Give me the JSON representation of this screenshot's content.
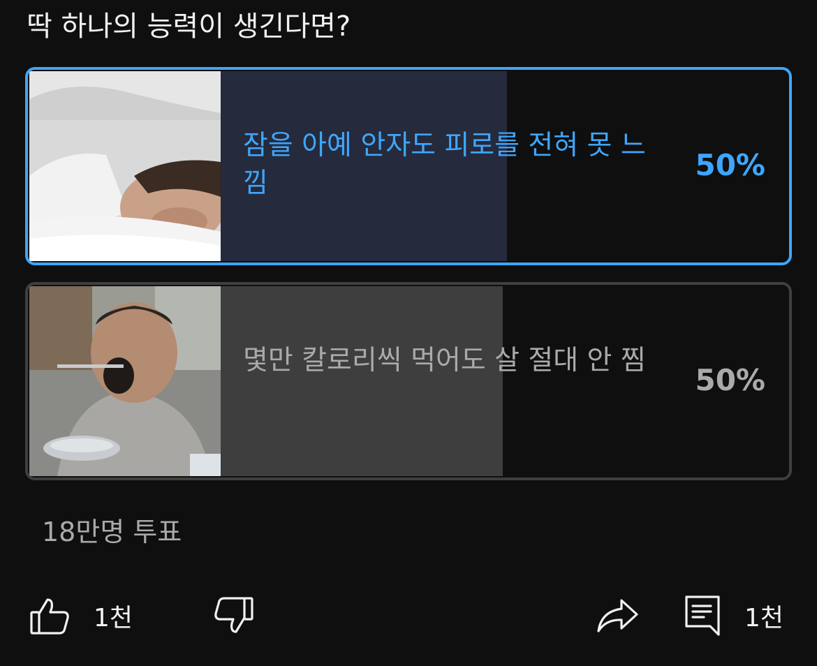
{
  "poll": {
    "question": "딱 하나의 능력이 생긴다면?",
    "options": [
      {
        "label": "잠을 아예 안자도 피로를 전혀 못 느낌",
        "percent": "50%",
        "fill_fraction": 0.5,
        "selected": true,
        "image": "sleeping-man-photo"
      },
      {
        "label": "몇만 칼로리씩 먹어도 살 절대 안 찜",
        "percent": "50%",
        "fill_fraction": 0.5,
        "selected": false,
        "image": "man-eating-photo"
      }
    ],
    "vote_count": "18만명 투표"
  },
  "actions": {
    "like_count": "1천",
    "comment_count": "1천",
    "icons": [
      "thumb-up-icon",
      "thumb-down-icon",
      "share-icon",
      "comment-icon"
    ]
  },
  "colors": {
    "background": "#0f0f0f",
    "accent": "#3ea6ff",
    "selected_fill": "#252a3c",
    "unselected_fill": "#3e3e3e",
    "unselected_border": "#3f3f3f",
    "muted_text": "#aaaaaa"
  }
}
